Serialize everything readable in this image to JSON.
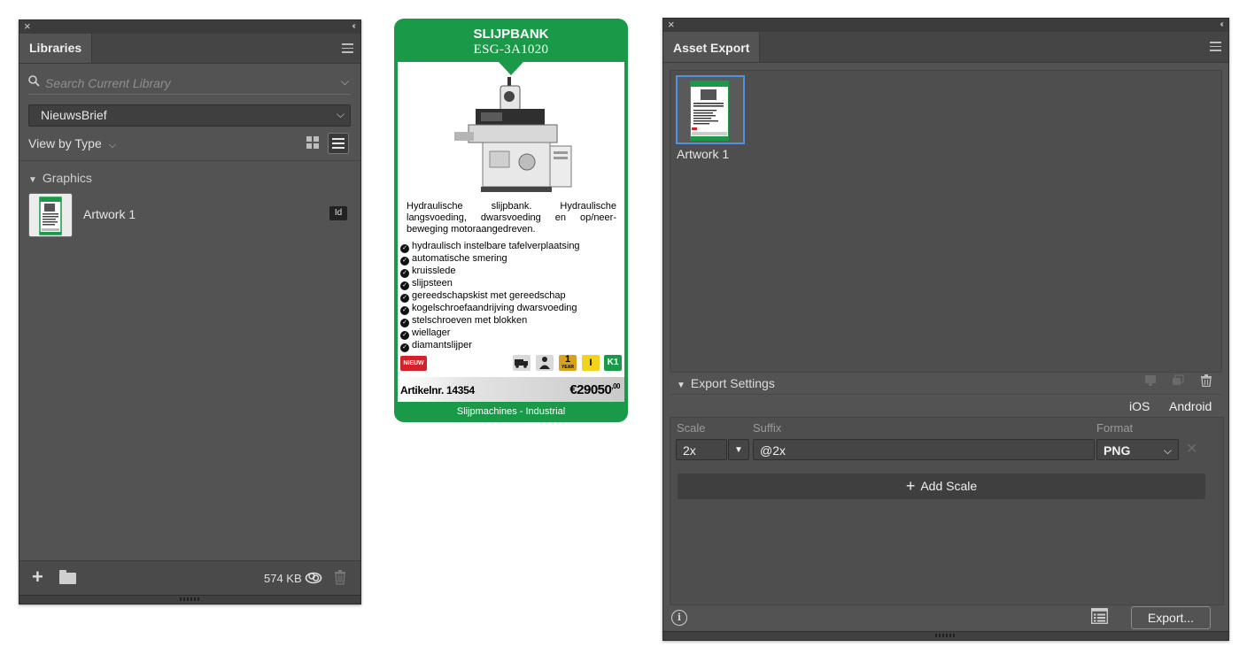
{
  "libraries_panel": {
    "tab_title": "Libraries",
    "search_placeholder": "Search Current Library",
    "selected_library": "NieuwsBrief",
    "view_by_label": "View by Type",
    "section_title": "Graphics",
    "items": [
      {
        "name": "Artwork 1",
        "badge": "Id"
      }
    ],
    "footer_size": "574 KB"
  },
  "product_card": {
    "title": "SLIJPBANK",
    "model": "ESG-3A1020",
    "description": "Hydraulische slijpbank. Hydraulische langsvoeding, dwarsvoeding en op/neer-beweging motoraangedreven.",
    "features": [
      "hydraulisch instelbare tafelverplaatsing",
      "automatische smering",
      "kruisslede",
      "slijpsteen",
      "gereedschapskist met gereedschap",
      "kogelschroefaandrijving dwarsvoeding",
      "stelschroeven met blokken",
      "wiellager",
      "diamantslijper"
    ],
    "new_badge": "NIEUW",
    "warranty_badge": "1",
    "warranty_sub": "YEAR",
    "class_badge": "I",
    "k_badge": "K1",
    "article_number": "Artikelnr. 14354",
    "price_main": "€29050",
    "price_cents": ",00",
    "footer": "Slijpmachines - Industrial",
    "colors": {
      "green": "#1a9a49",
      "red": "#d3232a",
      "yellow": "#f2d21b"
    }
  },
  "asset_export_panel": {
    "tab_title": "Asset Export",
    "assets": [
      {
        "name": "Artwork 1"
      }
    ],
    "export_settings_label": "Export Settings",
    "platform_ios": "iOS",
    "platform_android": "Android",
    "scale_label": "Scale",
    "suffix_label": "Suffix",
    "format_label": "Format",
    "scale_value": "2x",
    "suffix_value": "@2x",
    "format_value": "PNG",
    "add_scale_label": "Add Scale",
    "export_button": "Export..."
  }
}
